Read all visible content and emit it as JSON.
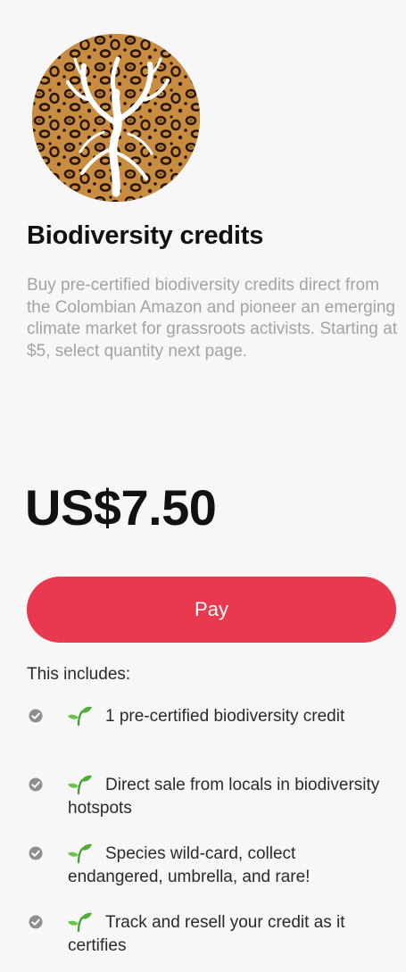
{
  "product": {
    "logo_icon": "leopard-print-tree-logo",
    "title": "Biodiversity credits",
    "description": "Buy pre-certified biodiversity credits direct from the Colombian Amazon and pioneer an emerging climate market for grassroots activists. Starting at $5, select quantity next page.",
    "price": "US$7.50"
  },
  "actions": {
    "pay_label": "Pay",
    "pay_color": "#e8394f"
  },
  "includes": {
    "title": "This includes:",
    "items": [
      {
        "icon": "sprout-icon",
        "text": "1 pre-certified biodiversity credit"
      },
      {
        "icon": "sprout-icon",
        "text": "Direct sale from locals in biodiversity hotspots"
      },
      {
        "icon": "sprout-icon",
        "text": "Species wild-card, collect endangered, umbrella, and rare!"
      },
      {
        "icon": "sprout-icon",
        "text": "Track and resell your credit as it certifies"
      }
    ]
  }
}
